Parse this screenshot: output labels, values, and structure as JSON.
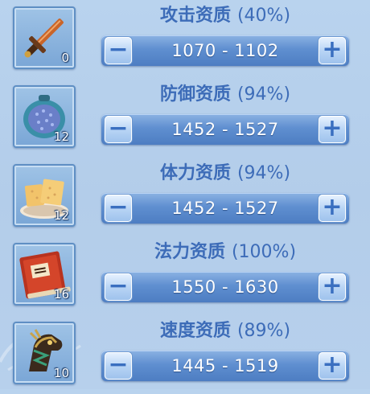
{
  "stats": [
    {
      "title": "攻击资质",
      "percent": "(40%)",
      "range": "1070 - 1102",
      "qty": "0",
      "icon": "sword-icon"
    },
    {
      "title": "防御资质",
      "percent": "(94%)",
      "range": "1452 - 1527",
      "qty": "12",
      "icon": "armor-pouch-icon"
    },
    {
      "title": "体力资质",
      "percent": "(94%)",
      "range": "1452 - 1527",
      "qty": "12",
      "icon": "cake-icon"
    },
    {
      "title": "法力资质",
      "percent": "(100%)",
      "range": "1550 - 1630",
      "qty": "16",
      "icon": "spellbook-icon"
    },
    {
      "title": "速度资质",
      "percent": "(89%)",
      "range": "1445 - 1519",
      "qty": "10",
      "icon": "horse-head-icon"
    }
  ],
  "buttons": {
    "minus": "−",
    "plus": "+"
  },
  "colors": {
    "title": "#3d6cb8",
    "bar": "#5f8fd0",
    "button_glyph": "#3a6fc0"
  }
}
